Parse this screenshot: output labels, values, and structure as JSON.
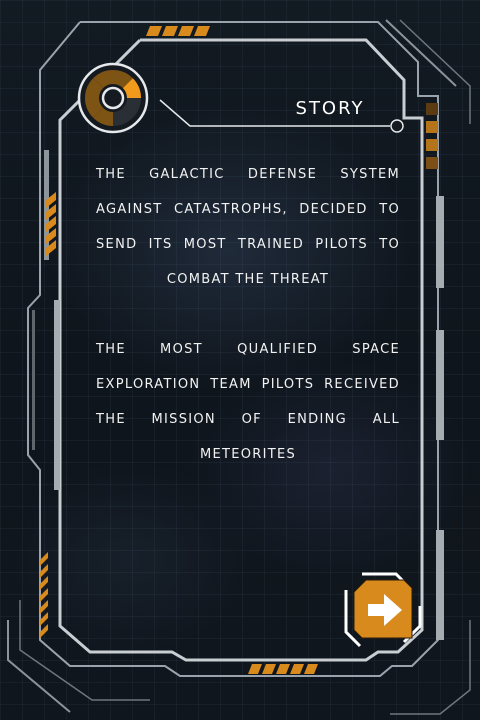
{
  "story": {
    "title": "STORY",
    "paragraphs": [
      "THE GALACTIC DEFENSE SYSTEM AGAINST CATASTROPHS, DECIDED TO SEND ITS MOST TRAINED PILOTS TO COMBAT THE THREAT",
      "THE MOST QUALIFIED SPACE EXPLORATION TEAM PILOTS RECEIVED THE MISSION OF ENDING ALL METEORITES"
    ]
  },
  "icons": {
    "gauge": "radial-gauge-icon",
    "next": "arrow-right-icon"
  },
  "colors": {
    "accent": "#e8941a",
    "frame": "#9aa3ab",
    "text": "#f2f2f2"
  }
}
